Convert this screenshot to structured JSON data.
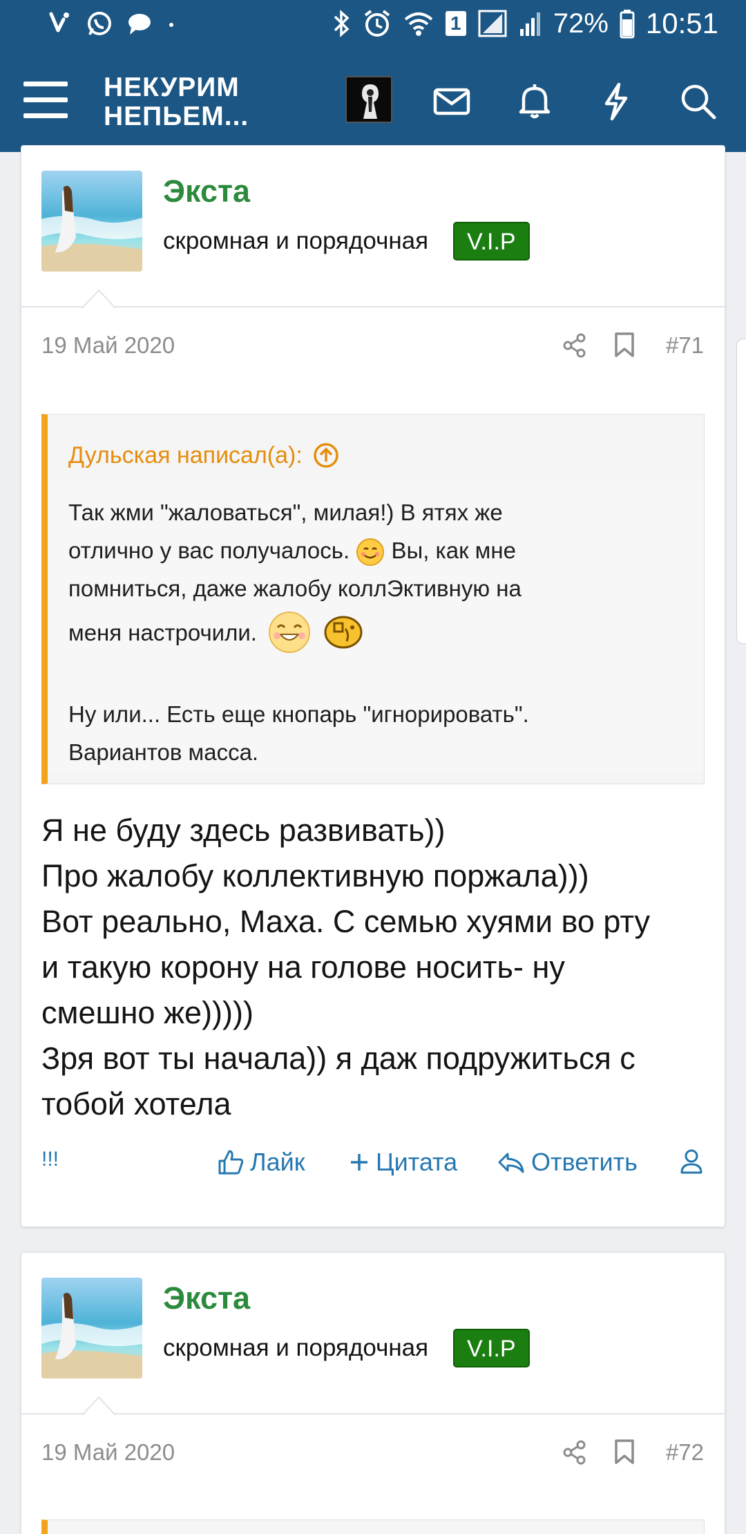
{
  "status_bar": {
    "battery_percent": "72%",
    "time": "10:51",
    "sim_badge": "1"
  },
  "header": {
    "logo_line1": "НЕКУРИМ",
    "logo_line2": "НЕПЬЕМ..."
  },
  "posts": [
    {
      "username": "Экста",
      "user_title": "скромная и порядочная",
      "badge": "V.I.P",
      "date": "19 Май 2020",
      "number": "#71",
      "quote": {
        "author": "Дульская написал(а):",
        "line1": "Так жми \"жаловаться\", милая!) В ятях же",
        "line2a": "отлично у вас получалось.",
        "line2b": "Вы, как мне",
        "line3": "помниться, даже жалобу коллЭктивную на",
        "line4": "меня настрочили.",
        "line5": "Ну или... Есть еще кнопарь \"игнорировать\".",
        "line6": "Вариантов масса."
      },
      "message": [
        "Я не буду здесь развивать))",
        "Про жалобу коллективную поржала)))",
        "Вот реально, Маха. С семью хуями во рту",
        "и такую корону на голове носить- ну",
        "смешно же)))))",
        "Зря вот ты начала)) я даж подружиться с",
        "тобой хотела"
      ],
      "actions": {
        "report": "!!!",
        "like": "Лайк",
        "quote": "Цитата",
        "reply": "Ответить"
      }
    },
    {
      "username": "Экста",
      "user_title": "скромная и порядочная",
      "badge": "V.I.P",
      "date": "19 Май 2020",
      "number": "#72"
    }
  ],
  "colors": {
    "header_bg": "#1b5684",
    "username": "#2c8a3c",
    "badge_bg": "#1a7e10",
    "quote_accent": "#f3a21c",
    "link": "#2577b1"
  }
}
